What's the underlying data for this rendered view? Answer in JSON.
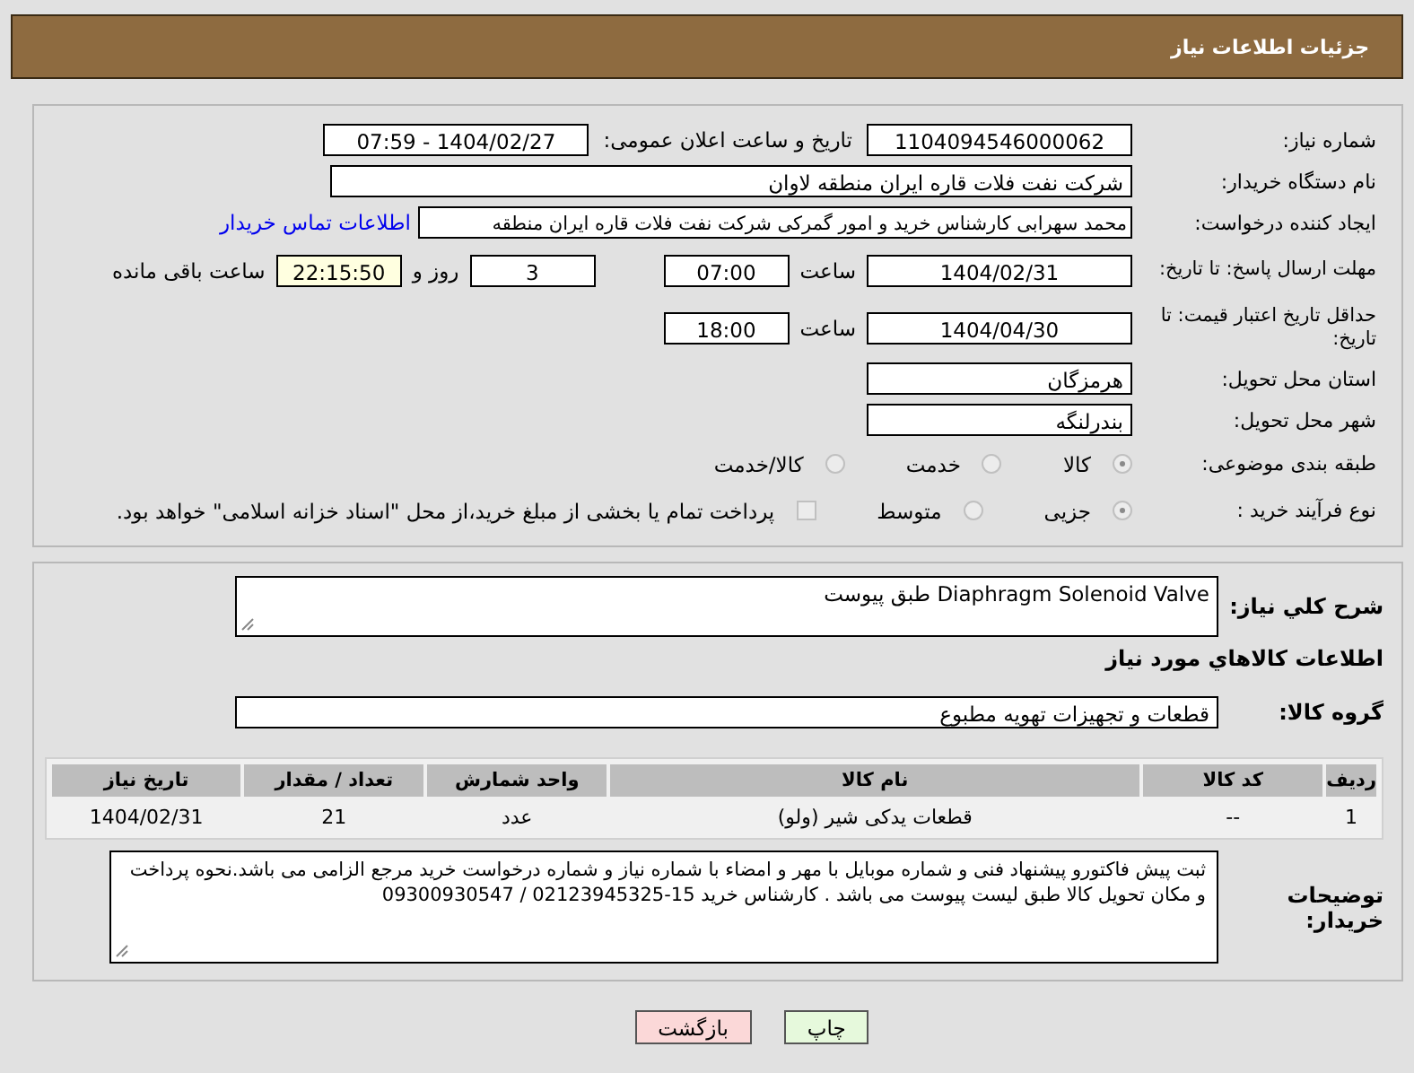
{
  "title": "جزئیات اطلاعات نیاز",
  "need_number": {
    "label": "شماره نیاز:",
    "value": "1104094546000062"
  },
  "announce": {
    "label": "تاریخ و ساعت اعلان عمومی:",
    "value": "1404/02/27 - 07:59"
  },
  "buyer_org": {
    "label": "نام دستگاه خریدار:",
    "value": "شرکت نفت فلات قاره ایران منطقه لاوان"
  },
  "requester": {
    "label": "ایجاد کننده درخواست:",
    "value": "محمد سهرابی کارشناس خرید و امور گمرکی شرکت نفت فلات قاره ایران منطقه",
    "link": "اطلاعات تماس خریدار"
  },
  "reply_deadline": {
    "label": "مهلت ارسال پاسخ: تا تاریخ:",
    "date": "1404/02/31",
    "time_label": "ساعت",
    "time": "07:00",
    "days": "3",
    "days_label": "روز و",
    "remaining": "22:15:50",
    "remaining_label": "ساعت باقی مانده"
  },
  "price_validity": {
    "label": "حداقل تاریخ اعتبار قیمت: تا تاریخ:",
    "date": "1404/04/30",
    "time_label": "ساعت",
    "time": "18:00"
  },
  "province": {
    "label": "استان محل تحویل:",
    "value": "هرمزگان"
  },
  "city": {
    "label": "شهر محل تحویل:",
    "value": "بندرلنگه"
  },
  "category": {
    "label": "طبقه بندی موضوعی:",
    "options": [
      {
        "label": "کالا",
        "selected": true
      },
      {
        "label": "خدمت",
        "selected": false
      },
      {
        "label": "کالا/خدمت",
        "selected": false
      }
    ]
  },
  "process": {
    "label": "نوع فرآیند خرید :",
    "options": [
      {
        "label": "جزیی",
        "selected": true
      },
      {
        "label": "متوسط",
        "selected": false
      }
    ],
    "payment_note": {
      "label": "پرداخت تمام یا بخشی از مبلغ خرید،از محل \"اسناد خزانه اسلامی\" خواهد بود.",
      "checked": false
    }
  },
  "description": {
    "label": "شرح کلي نياز:",
    "value": "Diaphragm Solenoid Valve طبق پیوست"
  },
  "goods_heading": "اطلاعات كالاهاي مورد نياز",
  "goods_group": {
    "label": "گروه كالا:",
    "value": "قطعات و تجهیزات تهویه مطبوع"
  },
  "table": {
    "columns": [
      "رديف",
      "كد كالا",
      "نام كالا",
      "واحد شمارش",
      "تعداد / مقدار",
      "تاريخ نياز"
    ],
    "rows": [
      [
        "1",
        "--",
        "قطعات یدکی شیر (ولو)",
        "عدد",
        "21",
        "1404/02/31"
      ]
    ]
  },
  "buyer_notes": {
    "label": "توضیحات خریدار:",
    "value": "ثبت پیش فاکتورو پیشنهاد فنی و شماره موبایل با مهر و امضاء با شماره نیاز و شماره درخواست خرید مرجع الزامی می باشد.نحوه پرداخت و مکان تحویل کالا طبق لیست پیوست می باشد .  کارشناس خرید 15-02123945325 / 09300930547"
  },
  "buttons": [
    {
      "label": "چاپ",
      "kind": "print"
    },
    {
      "label": "بازگشت",
      "kind": "back"
    }
  ]
}
